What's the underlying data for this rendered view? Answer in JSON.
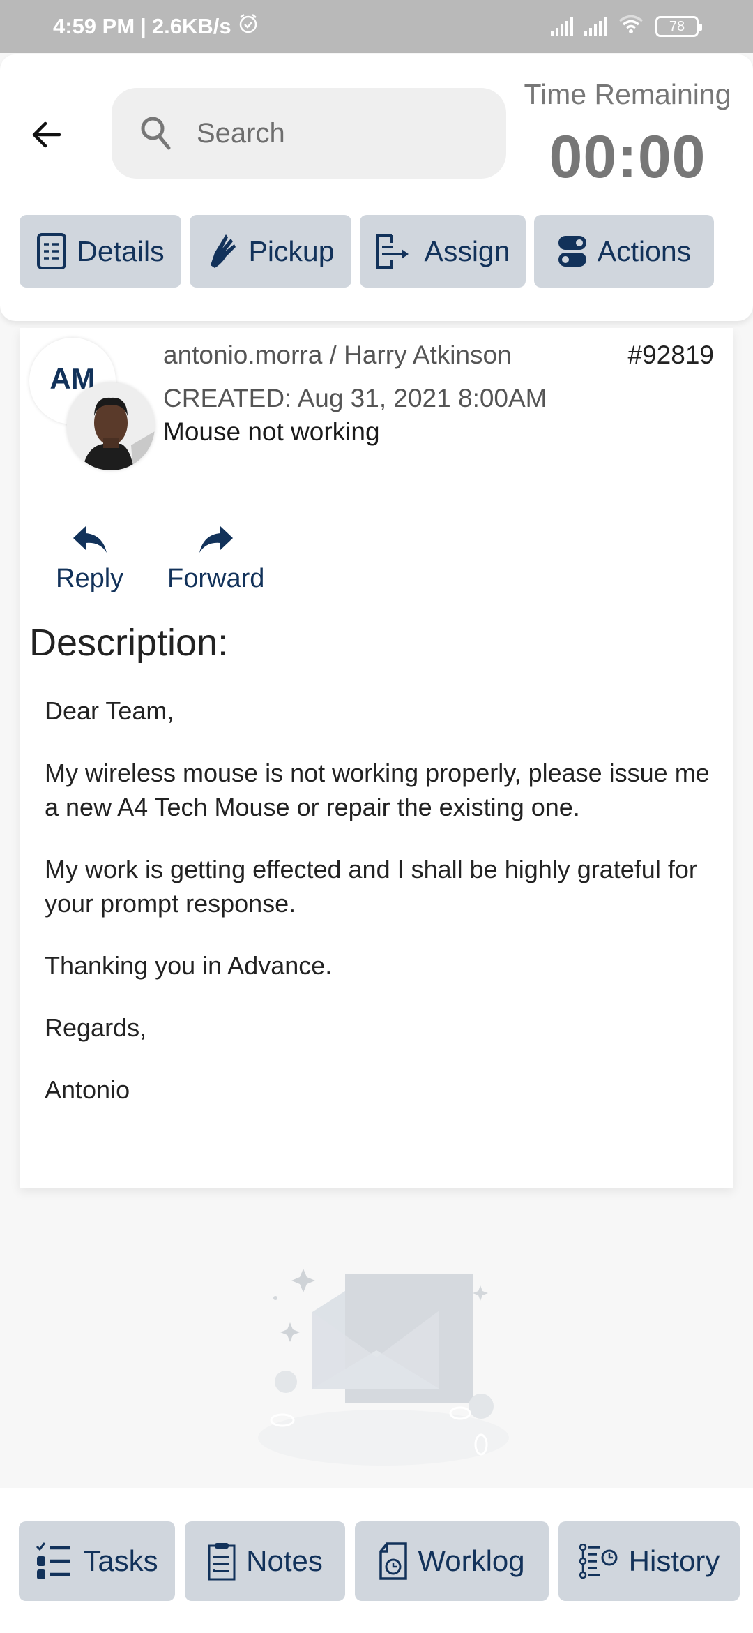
{
  "status_bar": {
    "time": "4:59 PM",
    "network_speed": "2.6KB/s",
    "battery": "78",
    "icons": [
      "alarm-icon",
      "signal-icon",
      "signal-icon",
      "wifi-icon",
      "battery-icon"
    ]
  },
  "header": {
    "back_icon": "arrow-left-icon",
    "search": {
      "placeholder": "Search",
      "value": ""
    },
    "time_remaining_label": "Time Remaining",
    "time_remaining_value": "00:00"
  },
  "top_tabs": [
    {
      "label": "Details",
      "icon": "details-list-icon"
    },
    {
      "label": "Pickup",
      "icon": "hand-pickup-icon"
    },
    {
      "label": "Assign",
      "icon": "assign-icon"
    },
    {
      "label": "Actions",
      "icon": "toggle-actions-icon"
    }
  ],
  "ticket": {
    "initials": "AM",
    "users": "antonio.morra / Harry Atkinson",
    "id": "#92819",
    "created": "CREATED: Aug 31, 2021 8:00AM",
    "subject": "Mouse not working",
    "reply_label": "Reply",
    "forward_label": "Forward",
    "description_heading": "Description:",
    "description": [
      "Dear Team,",
      "My wireless mouse is not working properly, please issue me a new A4 Tech Mouse or repair the existing one.",
      "My work is getting effected and I shall be highly grateful for your prompt response.",
      "Thanking you in Advance.",
      "Regards,",
      "Antonio"
    ]
  },
  "bottom_tabs": [
    {
      "label": "Tasks",
      "icon": "tasks-checklist-icon"
    },
    {
      "label": "Notes",
      "icon": "clipboard-notes-icon"
    },
    {
      "label": "Worklog",
      "icon": "worklog-clock-icon"
    },
    {
      "label": "History",
      "icon": "history-timeline-icon"
    }
  ],
  "colors": {
    "accent": "#12325a",
    "tab_bg": "#d0d6dd",
    "status_bar": "#b9b9b9"
  }
}
